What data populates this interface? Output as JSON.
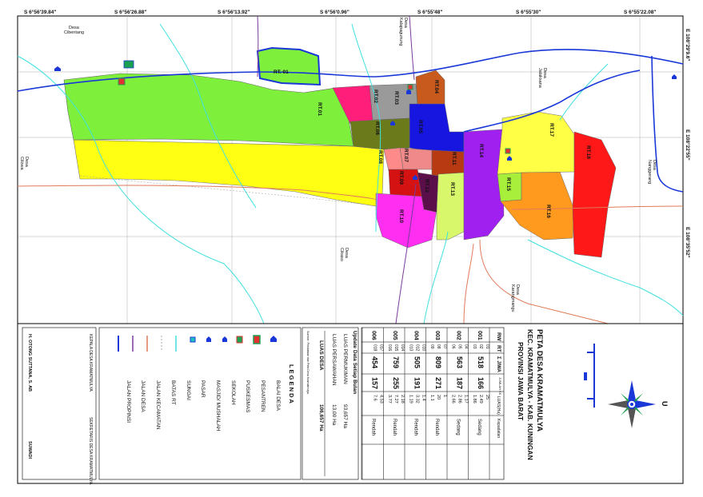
{
  "coords_top": [
    "S 6°56'39.84\"",
    "S 6°56'26.88\"",
    "S 6°56'13.92\"",
    "S 6°56'0.96\"",
    "S 6°55'48\"",
    "S 6°55'30\"",
    "S 6°55'22.08\""
  ],
  "coords_right": [
    "E 108°29'9.6\"",
    "E 108°22'55\"",
    "E 108°35'52\""
  ],
  "villages": [
    {
      "l1": "Desa",
      "l2": "Cibentang"
    },
    {
      "l1": "Desa",
      "l2": "Kalapagunung"
    },
    {
      "l1": "Desa",
      "l2": "Jalaksana"
    },
    {
      "l1": "Desa",
      "l2": "Cilowa"
    },
    {
      "l1": "Desa",
      "l2": "Nanggerang"
    },
    {
      "l1": "Desa",
      "l2": "Cikaso"
    },
    {
      "l1": "Desa",
      "l2": "Karangmangu"
    }
  ],
  "rt_labels": [
    "RT. 01",
    "RT.01",
    "RT.02",
    "RT.03",
    "RT.04",
    "RT.05",
    "RT.06",
    "RT.07",
    "RT.08",
    "RT.09",
    "RT.10",
    "RT.11",
    "RT.12",
    "RT.13",
    "RT.14",
    "RT.15",
    "RT.16",
    "RT.17",
    "RT.18"
  ],
  "title": {
    "line1": "PETA DESA KRAMATMULYA",
    "line2": "KEC. KRAMATMULYA - KAB. KUNINGAN",
    "line3": "PROVINSI JAWA BARAT"
  },
  "table": {
    "headers": {
      "rw": "RW",
      "rt": "RT",
      "jiwa": "Σ JIWA",
      "kk": "JUMLAH KK",
      "luas": "LUAS(Ha)",
      "kepadatan": "Kepadatan"
    },
    "rows": [
      {
        "rw": "001",
        "rts": [
          "01",
          "02",
          "03"
        ],
        "jiwa": "518",
        "kk": "166",
        "luas": [
          "25",
          "2.49",
          "1.86"
        ],
        "kepadatan": "Sedang"
      },
      {
        "rw": "002",
        "rts": [
          "04",
          "05",
          "06"
        ],
        "jiwa": "563",
        "kk": "187",
        "luas": [
          "1.17",
          "2.86",
          "2.66"
        ],
        "kepadatan": "Sedang"
      },
      {
        "rw": "003",
        "rts": [
          "07",
          "08",
          "09"
        ],
        "jiwa": "809",
        "kk": "271",
        "luas": [
          "1",
          "20",
          "1.1"
        ],
        "kepadatan": "Rendah"
      },
      {
        "rw": "004",
        "rts": [
          "010",
          "012",
          "013"
        ],
        "jiwa": "505",
        "kk": "191",
        "luas": [
          "1.4",
          "3.32",
          "1.19"
        ],
        "kepadatan": "Rendah"
      },
      {
        "rw": "005",
        "rts": [
          "014",
          "015",
          "016"
        ],
        "jiwa": "759",
        "kk": "255",
        "luas": [
          "2.18",
          "7.27",
          "3.77"
        ],
        "kepadatan": "Rendah"
      },
      {
        "rw": "006",
        "rts": [
          "017",
          "018"
        ],
        "jiwa": "454",
        "kk": "157",
        "luas": [
          "4.53",
          "7.6"
        ],
        "kepadatan": "Rendah"
      }
    ]
  },
  "luas": {
    "update_note": "Update Data Setiap Bulan",
    "permukiman_label": "LUAS PERMUKIMAN",
    "permukiman_value": "93,657 Ha",
    "persawahan_label": "LUAS PERSAWAHAN",
    "persawahan_value": "13,00 Ha",
    "desa_label": "LUAS DESA",
    "desa_value": "106,657 Ha",
    "source_note": "Sumber: Pendataan dan Peta Desa Kramatmulya"
  },
  "legend": {
    "title": "L E G E N D A",
    "items": [
      "BALAI DESA",
      "PESANTREN",
      "PUSKESMAS",
      "SEKOLAH",
      "MASJID/ MUSHALAH",
      "PASAR",
      "SUNGAI",
      "BATAS RT",
      "JALAN KECAMATAN",
      "JALAN DESA",
      "JALAN PROPINSI"
    ]
  },
  "signatures": {
    "left_title": "KEPALA DESA KRAMATMULYA",
    "left_name": "H. OTONG SUTTANA, S. AB",
    "right_title": "SEKRETARIS DESA KRAMATMULYA",
    "right_name": "SUWADI"
  },
  "compass_label": "U",
  "colors": {
    "rt01": "#7ef03c",
    "rt02": "#ff1f7a",
    "rt03": "#9a9a9a",
    "rt04": "#c85a1e",
    "rt05": "#1616e0",
    "rt06": "#6b7a1a",
    "rt07": "#f08a8a",
    "rt08": "#ff8a8a",
    "rt09": "#d41212",
    "rt10": "#ff2ef0",
    "rt11": "#b83a12",
    "rt12": "#5a0f4a",
    "rt13": "#d8f76a",
    "rt14": "#a020f0",
    "rt15": "#a8ef3c",
    "rt16": "#ff9a1e",
    "rt17": "#ffff46",
    "rt18": "#ff1818",
    "sawah": "#ffff14",
    "road_prov": "#1a38d8",
    "road_kec": "#e07a5a",
    "river": "#40e0e0"
  }
}
